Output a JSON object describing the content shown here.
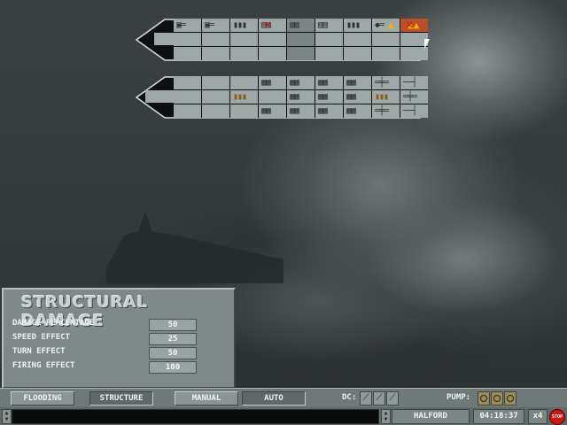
{
  "panel": {
    "title": "STRUCTURAL DAMAGE",
    "rows": [
      {
        "label": "DAMAGE PERCENTAGE",
        "value": "50"
      },
      {
        "label": "SPEED EFFECT",
        "value": "25"
      },
      {
        "label": "TURN EFFECT",
        "value": "50"
      },
      {
        "label": "FIRING EFFECT",
        "value": "100"
      }
    ]
  },
  "toolbar": {
    "flooding": "FLOODING",
    "structure": "STRUCTURE",
    "manual": "MANUAL",
    "auto": "AUTO",
    "dc_label": "DC:",
    "pump_label": "PUMP:"
  },
  "status": {
    "ship_name": "HALFORD",
    "clock": "04:18:37",
    "speed": "x4",
    "stop_label": "STOP"
  },
  "colors": {
    "damage_x": "#d01818",
    "fire": "#ffb000",
    "stop": "#c81818"
  }
}
